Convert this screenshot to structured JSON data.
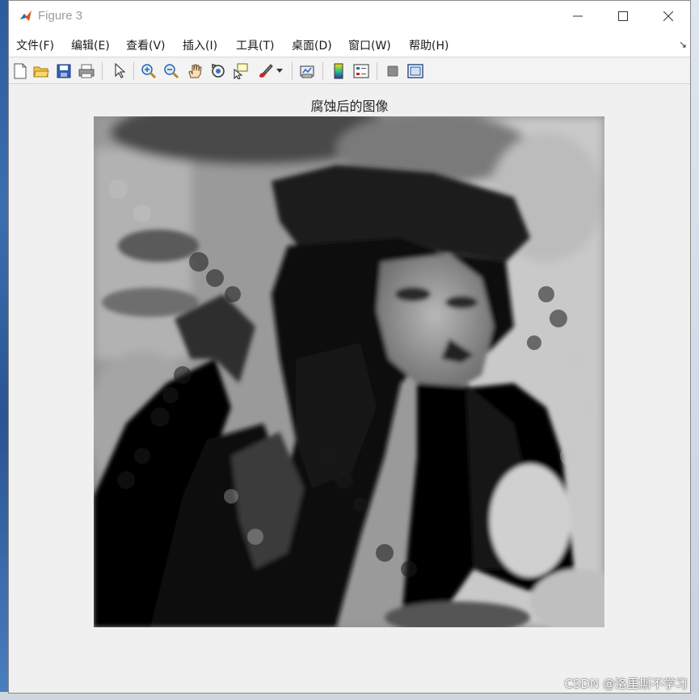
{
  "window": {
    "title": "Figure 3"
  },
  "menubar": {
    "items": [
      "文件(F)",
      "编辑(E)",
      "查看(V)",
      "插入(I)",
      "工具(T)",
      "桌面(D)",
      "窗口(W)",
      "帮助(H)"
    ],
    "overflow_arrow": "↘"
  },
  "toolbar": {
    "buttons": [
      "new-figure-icon",
      "open-file-icon",
      "save-icon",
      "print-icon",
      "edit-plot-arrow-icon",
      "zoom-in-icon",
      "zoom-out-icon",
      "pan-hand-icon",
      "rotate-3d-icon",
      "data-cursor-icon",
      "brush-icon",
      "brush-dropdown-icon",
      "link-plot-icon",
      "insert-colorbar-icon",
      "insert-legend-icon",
      "hide-plot-tools-icon",
      "show-plot-tools-icon"
    ]
  },
  "figure": {
    "axes_title": "腐蚀后的图像",
    "image_description_type": "grayscale eroded image"
  },
  "watermark": {
    "text": "CSDN @洛里斯不学习"
  },
  "colors": {
    "titlebar_bg": "#ffffff",
    "figure_bg": "#f0f0f0",
    "title_text": "#9a9a9a"
  }
}
